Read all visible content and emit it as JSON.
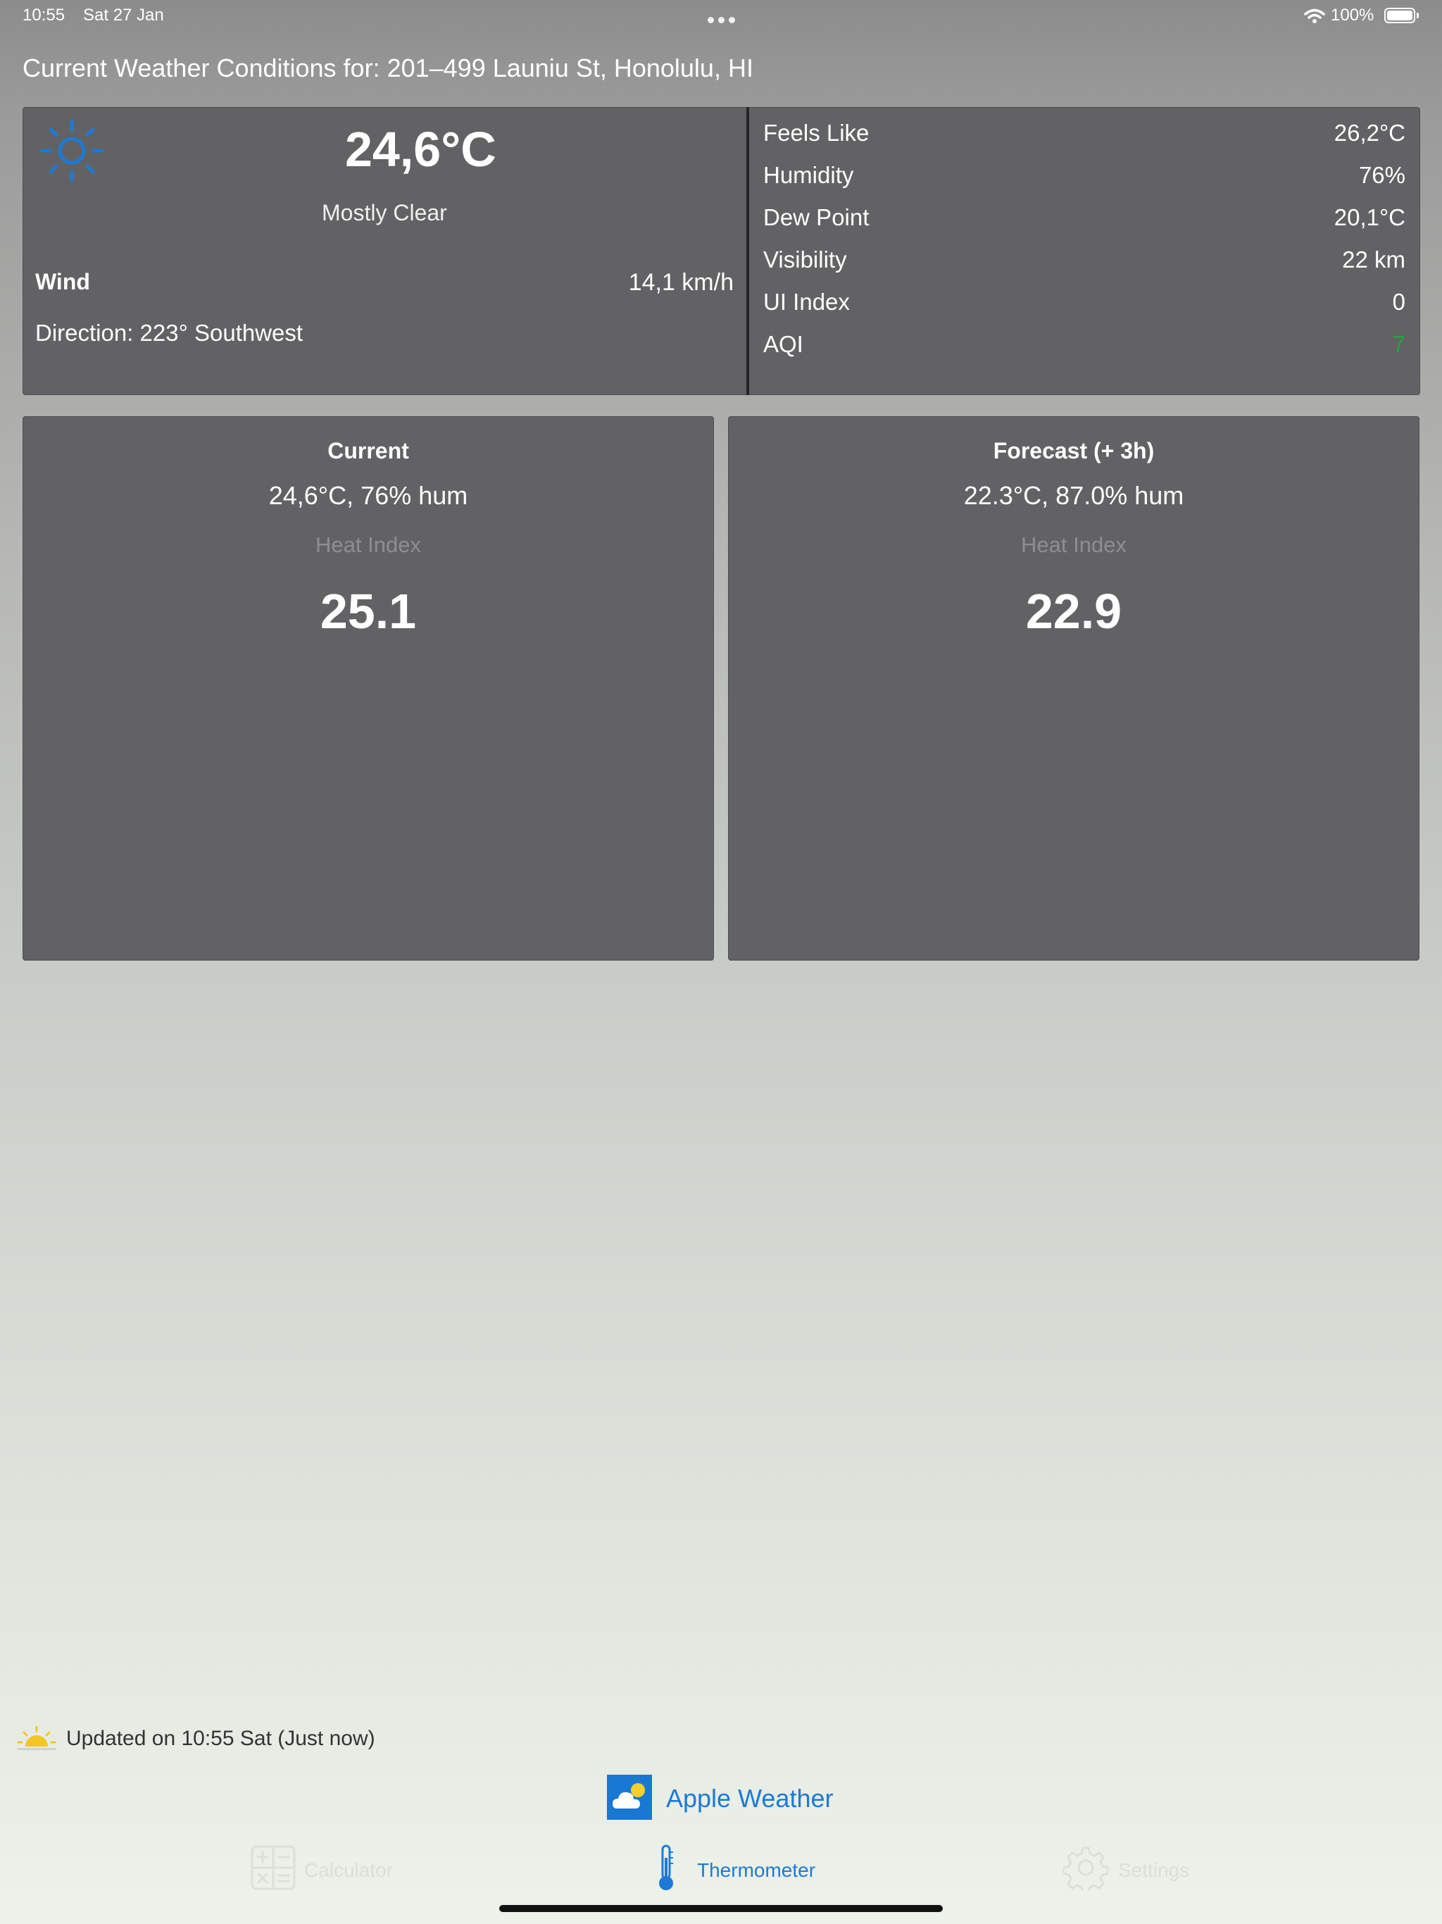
{
  "status_bar": {
    "time": "10:55",
    "date": "Sat 27 Jan",
    "battery": "100%"
  },
  "header": {
    "title": "Current Weather Conditions for: 201–499 Launiu St, Honolulu, HI"
  },
  "current": {
    "temperature": "24,6°C",
    "condition": "Mostly Clear",
    "wind_label": "Wind",
    "wind_speed": "14,1 km/h",
    "wind_direction": "Direction: 223° Southwest",
    "icon": "sun-icon"
  },
  "details": [
    {
      "label": "Feels Like",
      "value": "26,2°C"
    },
    {
      "label": "Humidity",
      "value": "76%"
    },
    {
      "label": "Dew Point",
      "value": "20,1°C"
    },
    {
      "label": "Visibility",
      "value": "22 km"
    },
    {
      "label": "UI Index",
      "value": "0"
    },
    {
      "label": "AQI",
      "value": "7",
      "color": "#26a33f"
    }
  ],
  "heat_cards": [
    {
      "title": "Current",
      "subtitle": "24,6°C, 76% hum",
      "label": "Heat Index",
      "value": "25.1"
    },
    {
      "title": "Forecast (+ 3h)",
      "subtitle": "22.3°C, 87.0% hum",
      "label": "Heat Index",
      "value": "22.9"
    }
  ],
  "footer": {
    "updated_text": "Updated on 10:55 Sat (Just now)",
    "source_label": "Apple Weather"
  },
  "tabs": [
    {
      "label": "Calculator",
      "icon": "calculator-icon",
      "active": false
    },
    {
      "label": "Thermometer",
      "icon": "thermometer-icon",
      "active": true
    },
    {
      "label": "Settings",
      "icon": "gear-icon",
      "active": false
    }
  ],
  "colors": {
    "accent": "#1c7ad6",
    "card": "#626264",
    "aqi_good": "#26a33f"
  }
}
